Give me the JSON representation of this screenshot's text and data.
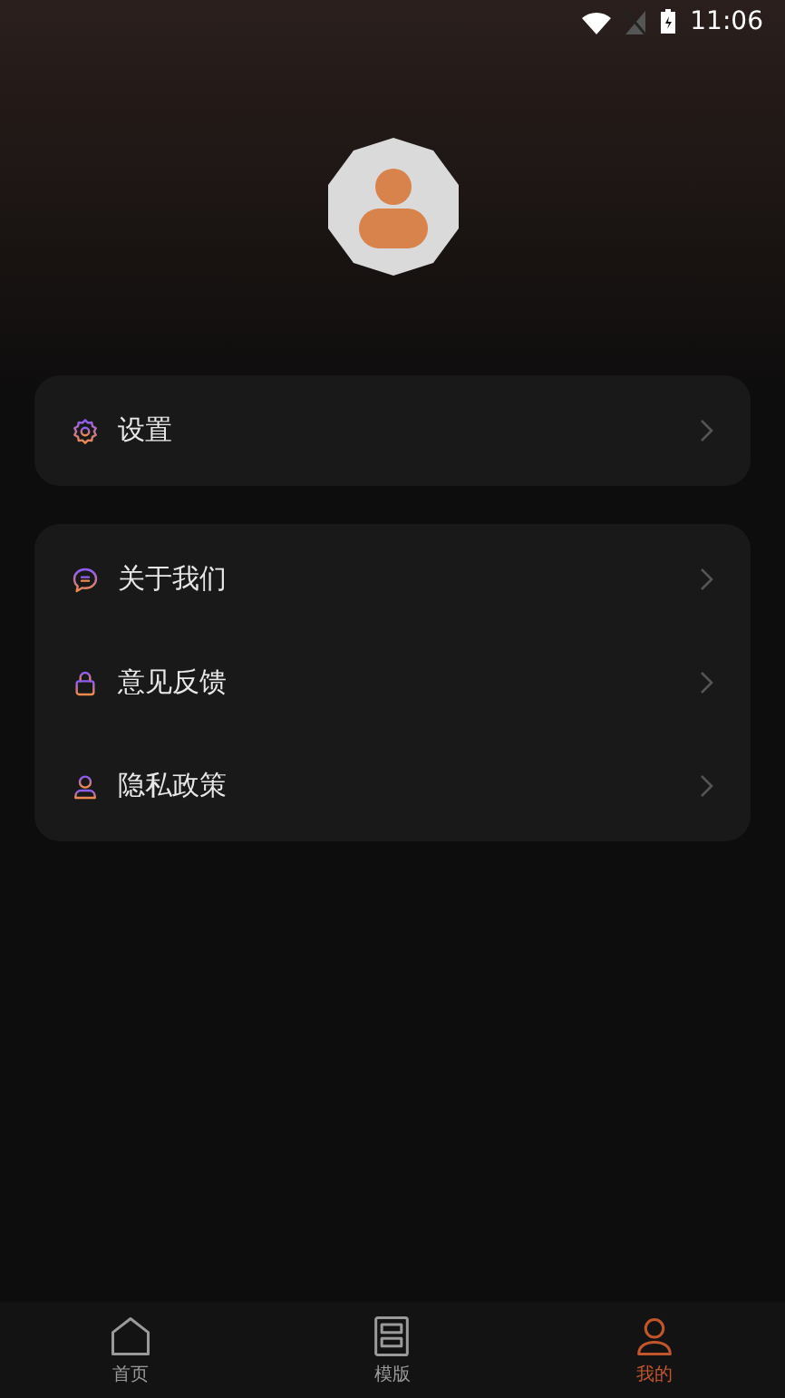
{
  "status_bar": {
    "time": "11:06"
  },
  "menu_groups": [
    {
      "items": [
        {
          "kind": "gear",
          "label": "设置"
        }
      ]
    },
    {
      "items": [
        {
          "kind": "chat",
          "label": "关于我们"
        },
        {
          "kind": "lock",
          "label": "意见反馈"
        },
        {
          "kind": "person",
          "label": "隐私政策"
        }
      ]
    }
  ],
  "tab_bar": [
    {
      "kind": "home",
      "label": "首页",
      "selected": false
    },
    {
      "kind": "template",
      "label": "模版",
      "selected": false
    },
    {
      "kind": "person",
      "label": "我的",
      "selected": true
    }
  ]
}
